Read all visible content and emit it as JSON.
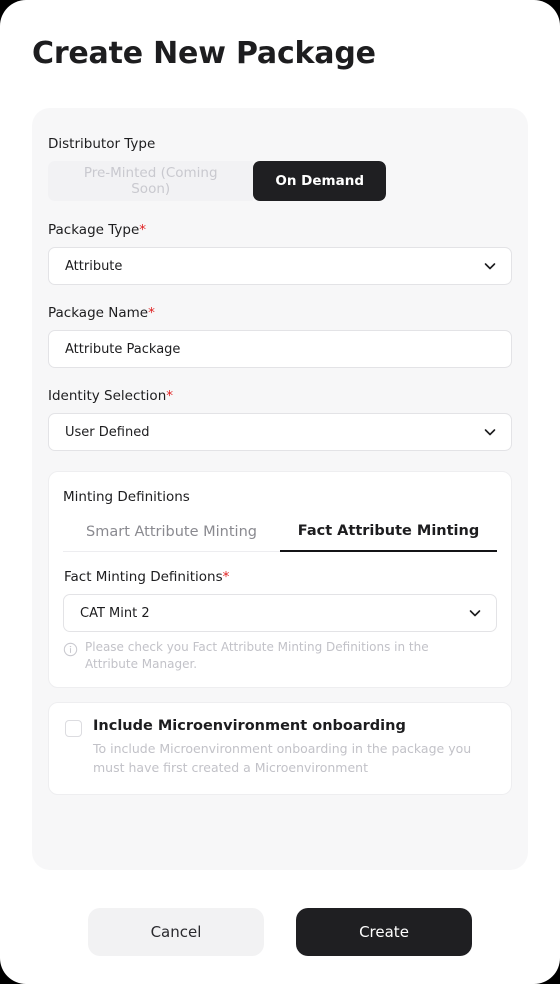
{
  "page": {
    "title": "Create New Package"
  },
  "distributor": {
    "label": "Distributor Type",
    "options": [
      {
        "label": "Pre-Minted (Coming Soon)",
        "state": "disabled"
      },
      {
        "label": "On Demand",
        "state": "selected"
      }
    ]
  },
  "package_type": {
    "label": "Package Type",
    "required_marker": "*",
    "value": "Attribute",
    "icon": "chevron-down-icon"
  },
  "package_name": {
    "label": "Package Name",
    "required_marker": "*",
    "value": "Attribute Package",
    "placeholder": "Attribute Package"
  },
  "identity_selection": {
    "label": "Identity Selection",
    "required_marker": "*",
    "value": "User Defined",
    "icon": "chevron-down-icon"
  },
  "minting": {
    "heading": "Minting Definitions",
    "tabs": [
      {
        "label": "Smart Attribute Minting",
        "active": false
      },
      {
        "label": "Fact Attribute Minting",
        "active": true
      }
    ],
    "definitions_label": "Fact Minting Definitions",
    "required_marker": "*",
    "definitions_value": "CAT Mint 2",
    "icon": "chevron-down-icon",
    "hint_icon": "info-icon",
    "hint": "Please check you Fact Attribute Minting Definitions in the Attribute Manager."
  },
  "microenvironment": {
    "checkbox_state": "unchecked",
    "title": "Include Microenvironment onboarding",
    "description": "To include Microenvironment onboarding in the package you must have first created a Microenvironment"
  },
  "footer": {
    "cancel_label": "Cancel",
    "create_label": "Create"
  },
  "colors": {
    "accent_dark": "#1f1f22",
    "required_red": "#e02020",
    "card_bg": "#f7f7f8",
    "muted_text": "#c2c2c8"
  }
}
